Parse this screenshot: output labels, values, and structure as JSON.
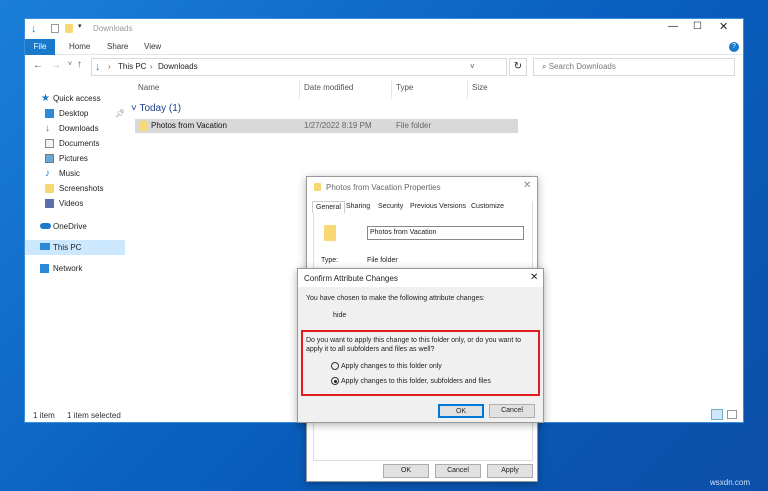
{
  "explorer": {
    "title": "Downloads",
    "ribbon_tabs": [
      "File",
      "Home",
      "Share",
      "View"
    ],
    "breadcrumb": [
      "This PC",
      "Downloads"
    ],
    "search_placeholder": "Search Downloads",
    "columns": [
      "Name",
      "Date modified",
      "Type",
      "Size"
    ],
    "group": "Today (1)",
    "rows": [
      {
        "name": "Photos from Vacation",
        "date": "1/27/2022 8:19 PM",
        "type": "File folder"
      }
    ],
    "nav": [
      {
        "label": "Quick access"
      },
      {
        "label": "Desktop"
      },
      {
        "label": "Downloads"
      },
      {
        "label": "Documents"
      },
      {
        "label": "Pictures"
      },
      {
        "label": "Music"
      },
      {
        "label": "Screenshots"
      },
      {
        "label": "Videos"
      },
      {
        "label": "OneDrive"
      },
      {
        "label": "This PC"
      },
      {
        "label": "Network"
      }
    ],
    "status": {
      "count": "1 item",
      "selected": "1 item selected"
    }
  },
  "properties": {
    "title": "Photos from Vacation Properties",
    "tabs": [
      "General",
      "Sharing",
      "Security",
      "Previous Versions",
      "Customize"
    ],
    "name_value": "Photos from Vacation",
    "type_label": "Type:",
    "type_value": "File folder",
    "ok": "OK",
    "cancel": "Cancel",
    "apply": "Apply"
  },
  "confirm": {
    "title": "Confirm Attribute Changes",
    "intro": "You have chosen to make the following attribute changes:",
    "change": "hide",
    "question": "Do you want to apply this change to this folder only, or do you want to apply it to all subfolders and files as well?",
    "option1": "Apply changes to this folder only",
    "option2": "Apply changes to this folder, subfolders and files",
    "selected": 2,
    "ok": "OK",
    "cancel": "Cancel"
  },
  "watermark": "wsxdn.com",
  "colors": {
    "accent": "#1979ca",
    "highlight": "#e81123"
  }
}
